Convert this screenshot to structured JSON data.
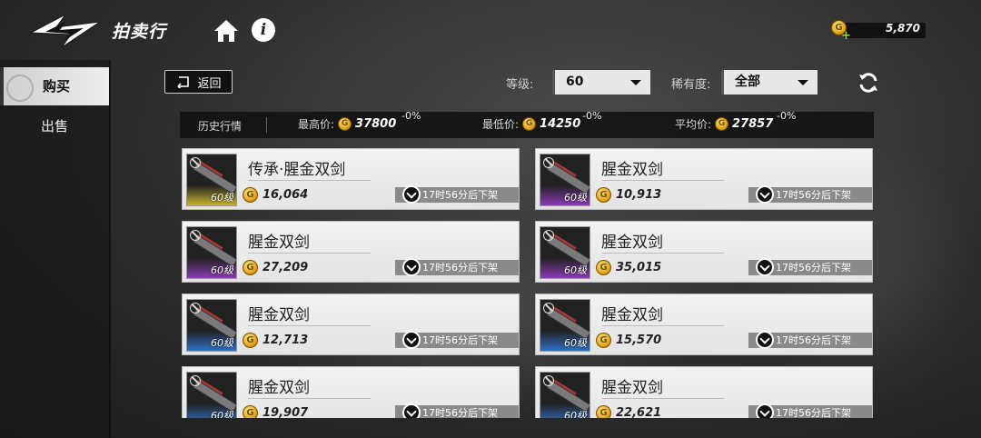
{
  "header": {
    "title": "拍卖行",
    "currency_value": "5,870",
    "icons": [
      "logo-icon",
      "home-icon",
      "info-icon",
      "coin-icon",
      "plus-icon"
    ]
  },
  "sidebar": {
    "items": [
      {
        "label": "购买",
        "active": true
      },
      {
        "label": "出售",
        "active": false
      }
    ]
  },
  "filters": {
    "back_label": "返回",
    "level_label": "等级:",
    "level_value": "60",
    "rarity_label": "稀有度:",
    "rarity_value": "全部"
  },
  "history": {
    "title": "历史行情",
    "max_label": "最高价:",
    "max_value": "37800",
    "max_pct": "-0%",
    "min_label": "最低价:",
    "min_value": "14250",
    "min_pct": "-0%",
    "avg_label": "平均价:",
    "avg_value": "27857",
    "avg_pct": "-0%"
  },
  "listings": [
    {
      "name": "传承·腥金双剑",
      "price": "16,064",
      "level": "60级",
      "time": "17时56分后下架",
      "glow": "#c9b32a"
    },
    {
      "name": "腥金双剑",
      "price": "10,913",
      "level": "60级",
      "time": "17时56分后下架",
      "glow": "#8a3bb3"
    },
    {
      "name": "腥金双剑",
      "price": "27,209",
      "level": "60级",
      "time": "17时56分后下架",
      "glow": "#8a3bb3"
    },
    {
      "name": "腥金双剑",
      "price": "35,015",
      "level": "60级",
      "time": "17时56分后下架",
      "glow": "#8a3bb3"
    },
    {
      "name": "腥金双剑",
      "price": "12,713",
      "level": "60级",
      "time": "17时56分后下架",
      "glow": "#2f6fc2"
    },
    {
      "name": "腥金双剑",
      "price": "15,570",
      "level": "60级",
      "time": "17时56分后下架",
      "glow": "#2f6fc2"
    },
    {
      "name": "腥金双剑",
      "price": "19,907",
      "level": "60级",
      "time": "17时56分后下架",
      "glow": "#2f6fc2"
    },
    {
      "name": "腥金双剑",
      "price": "22,621",
      "level": "60级",
      "time": "17时56分后下架",
      "glow": "#2f6fc2"
    }
  ]
}
